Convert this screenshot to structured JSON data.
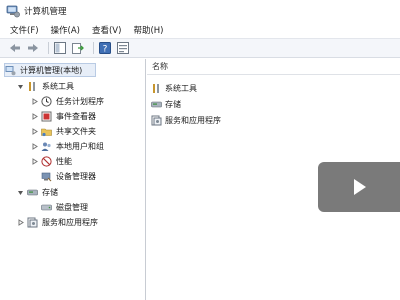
{
  "window": {
    "title": "计算机管理"
  },
  "menu": [
    {
      "label": "文件(F)"
    },
    {
      "label": "操作(A)"
    },
    {
      "label": "查看(V)"
    },
    {
      "label": "帮助(H)"
    }
  ],
  "toolbar": {
    "icons": [
      "back-arrow-icon",
      "forward-arrow-icon",
      "show-tree-icon",
      "export-icon",
      "help-icon",
      "properties-icon"
    ]
  },
  "tree": {
    "root": "计算机管理(本地)",
    "system_tools": "系统工具",
    "task_scheduler": "任务计划程序",
    "event_viewer": "事件查看器",
    "shared_folders": "共享文件夹",
    "local_users": "本地用户和组",
    "performance": "性能",
    "device_manager": "设备管理器",
    "storage": "存储",
    "disk_management": "磁盘管理",
    "services_apps": "服务和应用程序"
  },
  "list": {
    "column_name": "名称",
    "items": [
      "系统工具",
      "存储",
      "服务和应用程序"
    ]
  },
  "colors": {
    "selection": "#e7eef8",
    "accent": "#3a6ea5"
  }
}
